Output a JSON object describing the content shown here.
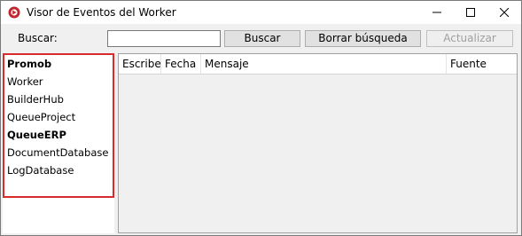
{
  "window": {
    "title": "Visor de Eventos del Worker",
    "icon": "app-logo-icon"
  },
  "toolbar": {
    "search_label": "Buscar:",
    "search_value": "",
    "search_button": "Buscar",
    "clear_button": "Borrar búsqueda",
    "refresh_button": "Actualizar"
  },
  "tree": {
    "items": [
      {
        "label": "Promob",
        "bold": true
      },
      {
        "label": "Worker",
        "bold": false
      },
      {
        "label": "BuilderHub",
        "bold": false
      },
      {
        "label": "QueueProject",
        "bold": false
      },
      {
        "label": "QueueERP",
        "bold": true
      },
      {
        "label": "DocumentDatabase",
        "bold": false
      },
      {
        "label": "LogDatabase",
        "bold": false
      }
    ]
  },
  "grid": {
    "columns": [
      "Escribe",
      "Fecha",
      "Mensaje",
      "Fuente"
    ]
  },
  "colors": {
    "highlight_border": "#d92b2b",
    "app_icon": "#c0262d"
  }
}
